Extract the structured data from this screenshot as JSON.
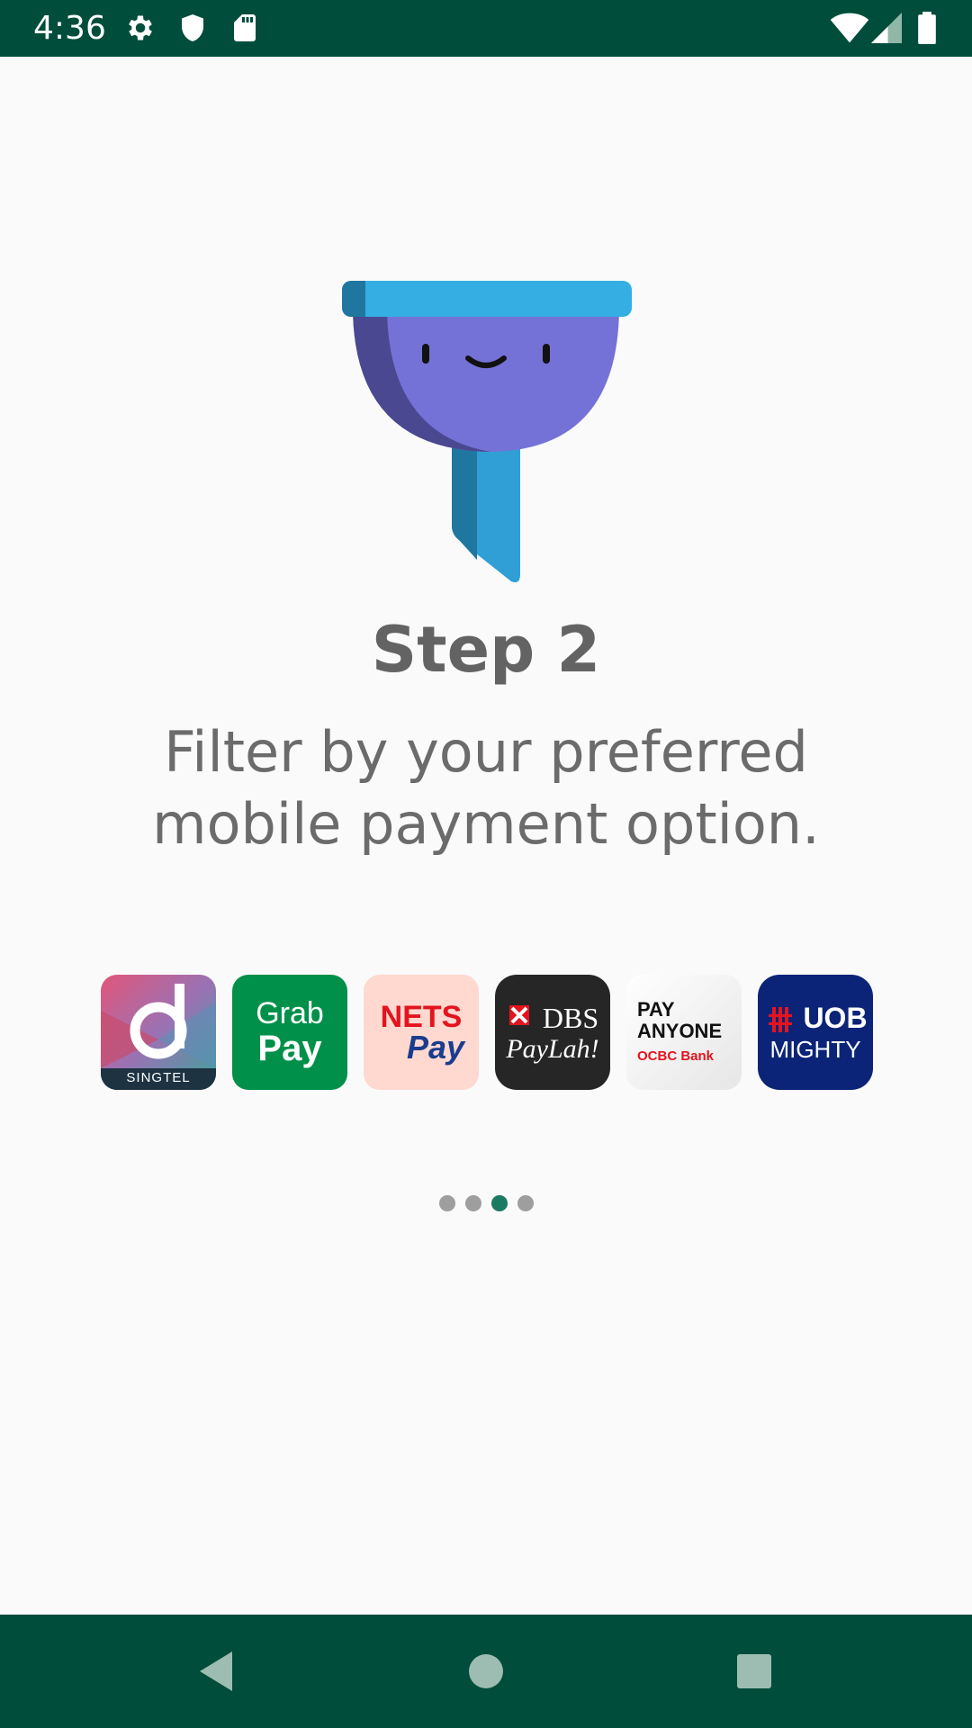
{
  "status_bar": {
    "time": "4:36",
    "left_icons": [
      "gear-icon",
      "shield-icon",
      "sd-card-icon"
    ],
    "right_icons": [
      "wifi-icon",
      "cellular-signal-icon",
      "battery-icon"
    ],
    "background_color": "#004d3b"
  },
  "onboarding": {
    "illustration": "funnel-mascot-illustration",
    "title": "Step 2",
    "description_line1": "Filter by your preferred",
    "description_line2": "mobile payment option.",
    "logos": [
      {
        "id": "singtel-dash",
        "caption": "SINGTEL"
      },
      {
        "id": "grabpay",
        "line1": "Grab",
        "line2": "Pay"
      },
      {
        "id": "nets-pay",
        "line1": "NETS",
        "line2": "Pay"
      },
      {
        "id": "dbs-paylah",
        "line1": "DBS",
        "line2": "PayLah!"
      },
      {
        "id": "pay-anyone-ocbc",
        "line1": "PAY",
        "line2": "ANYONE",
        "line3": "OCBC Bank"
      },
      {
        "id": "uob-mighty",
        "line1": "UOB",
        "line2": "MIGHTY"
      }
    ],
    "pager": {
      "total": 4,
      "active_index": 2,
      "active_color": "#1b7a62",
      "inactive_color": "#9e9e9e"
    }
  },
  "nav_bar": {
    "buttons": [
      "back-icon",
      "home-icon",
      "recents-icon"
    ],
    "background_color": "#004d3b"
  }
}
